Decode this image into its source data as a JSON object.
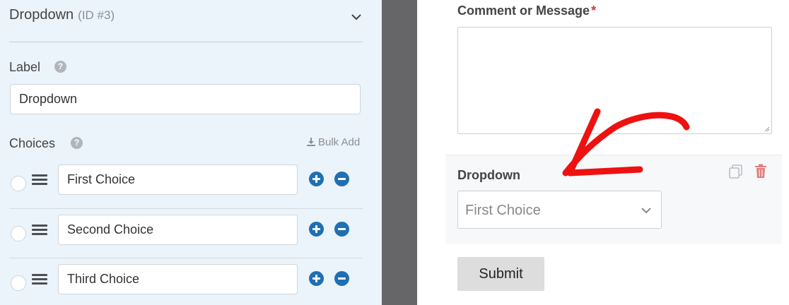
{
  "options_panel": {
    "field_title": "Dropdown",
    "field_id": "(ID #3)",
    "label_section": {
      "label": "Label",
      "help_glyph": "?",
      "value": "Dropdown"
    },
    "choices_section": {
      "label": "Choices",
      "help_glyph": "?",
      "bulk_add_label": "Bulk Add",
      "items": [
        {
          "value": "First Choice"
        },
        {
          "value": "Second Choice"
        },
        {
          "value": "Third Choice"
        }
      ]
    }
  },
  "preview": {
    "comment_field": {
      "label": "Comment or Message",
      "required_marker": "*",
      "value": ""
    },
    "dropdown_field": {
      "label": "Dropdown",
      "selected_value": "First Choice"
    },
    "submit_label": "Submit"
  },
  "icons": {
    "collapse": "chevron-down-icon",
    "help": "question-circle-icon",
    "bulk_add": "download-icon",
    "drag": "drag-handle-icon",
    "add": "plus-circle-icon",
    "remove": "minus-circle-icon",
    "duplicate": "duplicate-icon",
    "delete": "trash-icon"
  },
  "colors": {
    "panel_bg": "#ebf3fb",
    "gutter": "#666668",
    "accent_blue": "#1f6fb3",
    "required_red": "#d63638",
    "delete_red": "#e27c7c",
    "annotation_red": "#ee1111"
  }
}
